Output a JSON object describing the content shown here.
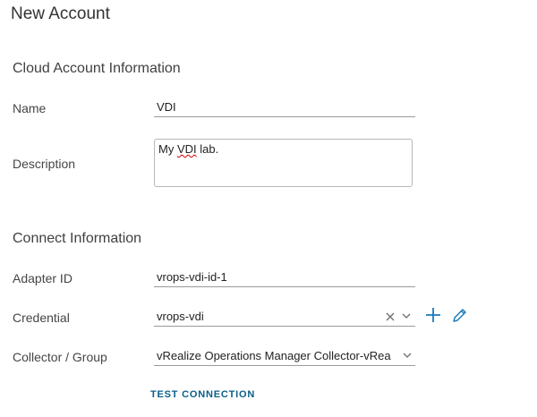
{
  "header": {
    "title": "New Account"
  },
  "cloud_account": {
    "section_title": "Cloud Account Information",
    "name_label": "Name",
    "name_value": "VDI",
    "description_label": "Description",
    "description_value_pre": "My ",
    "description_value_word": "VDI",
    "description_value_post": " lab."
  },
  "connect": {
    "section_title": "Connect Information",
    "adapter_id_label": "Adapter ID",
    "adapter_id_value": "vrops-vdi-id-1",
    "credential_label": "Credential",
    "credential_value": "vrops-vdi",
    "collector_label": "Collector / Group",
    "collector_value": "vRealize Operations Manager Collector-vRea"
  },
  "actions": {
    "test_connection": "TEST CONNECTION"
  },
  "icons": {
    "clear": "clear-x-icon",
    "chevron": "chevron-down-icon",
    "add": "plus-icon",
    "edit": "pencil-icon"
  },
  "colors": {
    "accent": "#0a5e8a",
    "icon_blue": "#1a7ab8"
  }
}
